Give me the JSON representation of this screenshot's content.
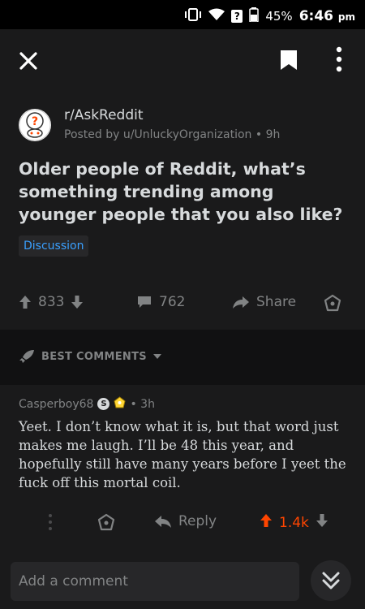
{
  "status_bar": {
    "battery": "45%",
    "time": "6:46",
    "ampm": "pm",
    "icons": [
      "vibrate-icon",
      "wifi-icon",
      "no-sim-icon",
      "no-sim-icon",
      "battery-icon"
    ]
  },
  "app_bar": {
    "icons": [
      "close-icon",
      "bookmark-icon",
      "more-vertical-icon"
    ]
  },
  "post": {
    "subreddit": "r/AskReddit",
    "posted_by": "Posted by u/UnluckyOrganization • 9h",
    "title": "Older people of Reddit, what’s something trending among younger people that you also like?",
    "flair": "Discussion",
    "flair_color": "#3aa0ff",
    "upvotes": "833",
    "comments": "762",
    "share_label": "Share"
  },
  "sort": {
    "label": "BEST COMMENTS"
  },
  "comment": {
    "author": "Casperboy68",
    "badge": "S",
    "age": "• 3h",
    "body": "Yeet. I don’t know what it is, but that word just makes me laugh. I’ll be 48 this year, and hopefully still have many years before I yeet the fuck off this mortal coil.",
    "reply_label": "Reply",
    "score": "1.4k",
    "score_color": "#ff4500"
  },
  "composer": {
    "placeholder": "Add a comment"
  },
  "colors": {
    "background": "#1a1a1b",
    "text": "#d7dadc",
    "muted": "#818384",
    "upvote": "#ff4500"
  }
}
